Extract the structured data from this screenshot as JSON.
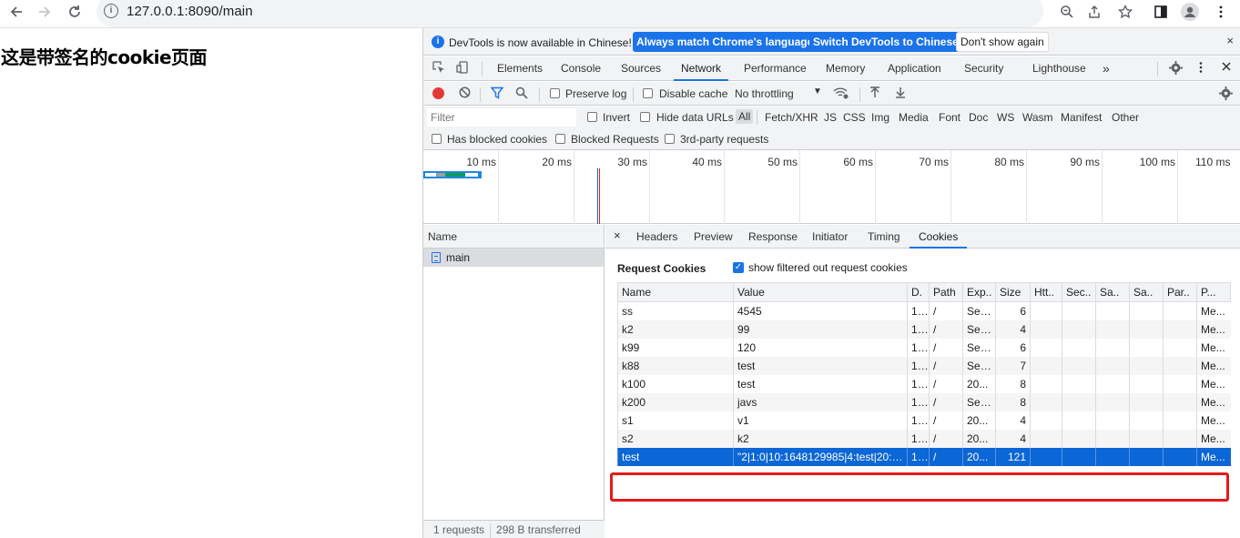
{
  "browser": {
    "url": "127.0.0.1:8090/main"
  },
  "page": {
    "heading": "这是带签名的cookie页面"
  },
  "devtools": {
    "infobar": {
      "message": "DevTools is now available in Chinese!",
      "btn_match": "Always match Chrome's language",
      "btn_switch": "Switch DevTools to Chinese",
      "btn_dismiss": "Don't show again",
      "close": "×"
    },
    "tabs": [
      "Elements",
      "Console",
      "Sources",
      "Network",
      "Performance",
      "Memory",
      "Application",
      "Security",
      "Lighthouse"
    ],
    "active_tab": "Network",
    "more_tabs": "»",
    "toolbar": {
      "preserve_log": "Preserve log",
      "disable_cache": "Disable cache",
      "throttling": "No throttling"
    },
    "filter": {
      "placeholder": "Filter",
      "invert": "Invert",
      "hide_data_urls": "Hide data URLs",
      "types": [
        "All",
        "Fetch/XHR",
        "JS",
        "CSS",
        "Img",
        "Media",
        "Font",
        "Doc",
        "WS",
        "Wasm",
        "Manifest",
        "Other"
      ],
      "has_blocked_cookies": "Has blocked cookies",
      "blocked_requests": "Blocked Requests",
      "third_party": "3rd-party requests"
    },
    "overview_ticks": [
      "10 ms",
      "20 ms",
      "30 ms",
      "40 ms",
      "50 ms",
      "60 ms",
      "70 ms",
      "80 ms",
      "90 ms",
      "100 ms",
      "110 ms"
    ],
    "request_list": {
      "header": "Name",
      "rows": [
        "main"
      ],
      "status_requests": "1 requests",
      "status_transferred": "298 B transferred"
    },
    "detail": {
      "close": "×",
      "tabs": [
        "Headers",
        "Preview",
        "Response",
        "Initiator",
        "Timing",
        "Cookies"
      ],
      "active_tab": "Cookies",
      "request_cookies_title": "Request Cookies",
      "show_filtered_label": "show filtered out request cookies",
      "columns": [
        "Name",
        "Value",
        "D.",
        "Path",
        "Exp..",
        "Size",
        "Htt..",
        "Sec..",
        "Sa..",
        "Sa..",
        "Par..",
        "P..."
      ],
      "rows": [
        [
          "ss",
          "4545",
          "1...",
          "/",
          "Ses...",
          "6",
          "",
          "",
          "",
          "",
          "",
          "Me..."
        ],
        [
          "k2",
          "99",
          "1...",
          "/",
          "Ses...",
          "4",
          "",
          "",
          "",
          "",
          "",
          "Me..."
        ],
        [
          "k99",
          "120",
          "1...",
          "/",
          "Ses...",
          "6",
          "",
          "",
          "",
          "",
          "",
          "Me..."
        ],
        [
          "k88",
          "test",
          "1...",
          "/",
          "Ses...",
          "7",
          "",
          "",
          "",
          "",
          "",
          "Me..."
        ],
        [
          "k100",
          "test",
          "1...",
          "/",
          "20...",
          "8",
          "",
          "",
          "",
          "",
          "",
          "Me..."
        ],
        [
          "k200",
          "javs",
          "1...",
          "/",
          "Ses...",
          "8",
          "",
          "",
          "",
          "",
          "",
          "Me..."
        ],
        [
          "s1",
          "v1",
          "1...",
          "/",
          "20...",
          "4",
          "",
          "",
          "",
          "",
          "",
          "Me..."
        ],
        [
          "s2",
          "k2",
          "1...",
          "/",
          "20...",
          "4",
          "",
          "",
          "",
          "",
          "",
          "Me..."
        ],
        [
          "test",
          "\"2|1:0|10:1648129985|4:test|20:c...",
          "1...",
          "/",
          "20...",
          "121",
          "",
          "",
          "",
          "",
          "",
          "Me..."
        ]
      ],
      "selected_row": 8
    }
  }
}
